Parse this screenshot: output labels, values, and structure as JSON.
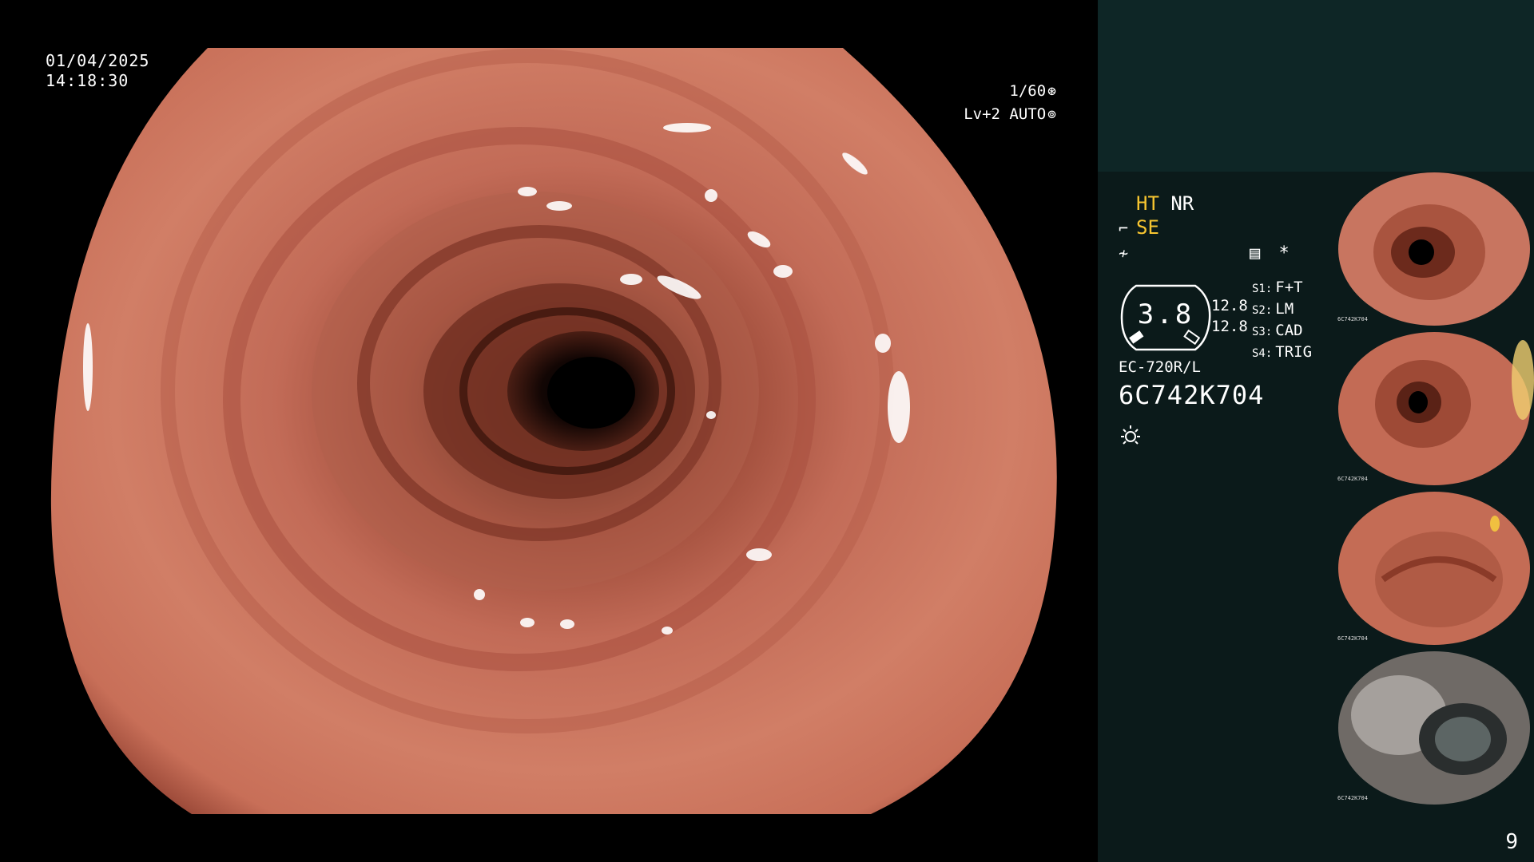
{
  "osd": {
    "date": "01/04/2025",
    "time": "14:18:30",
    "shutter": "1/60",
    "shutter_icon": "aperture-icon",
    "iris": "Lv+2 AUTO",
    "iris_icon": "iris-icon"
  },
  "panel": {
    "mode_ht": "HT",
    "mode_nr": "NR",
    "mode_se": "SE",
    "gauge_value": "3.8",
    "readout_1": "12.8",
    "readout_2": "12.8",
    "switches": [
      {
        "key": "S1:",
        "value": "F+T"
      },
      {
        "key": "S2:",
        "value": "LM"
      },
      {
        "key": "S3:",
        "value": "CAD"
      },
      {
        "key": "S4:",
        "value": "TRIG"
      }
    ],
    "asterisk": "*",
    "scope_model": "EC-720R/L",
    "scope_serial": "6C742K704",
    "accent_color": "#f7c530"
  },
  "thumbnails": [
    {
      "label": "6C742K704"
    },
    {
      "label": "6C742K704"
    },
    {
      "label": "6C742K704"
    },
    {
      "label": "6C742K704"
    }
  ],
  "page_number": "9"
}
